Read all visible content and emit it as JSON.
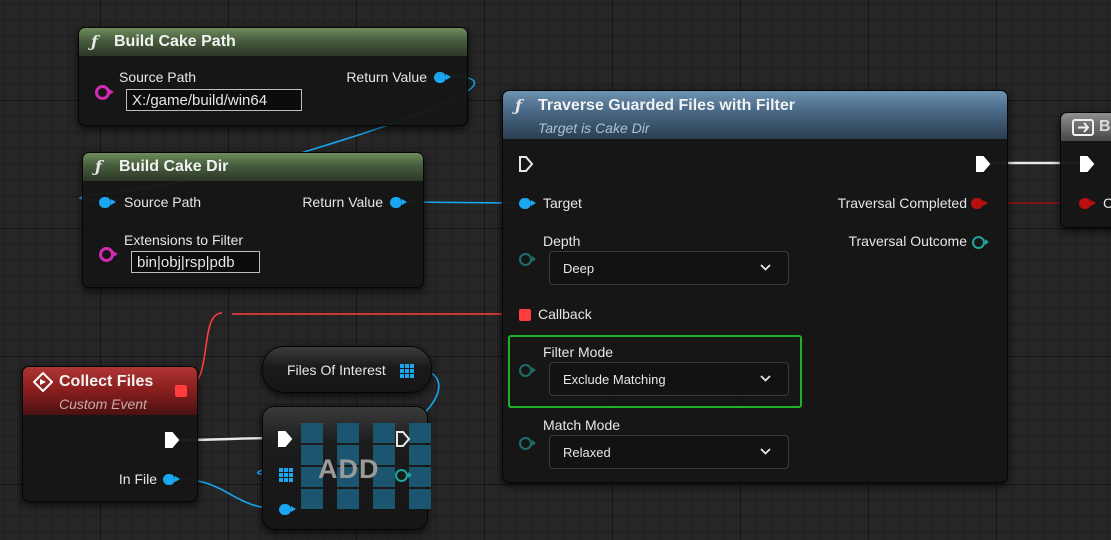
{
  "nodes": {
    "build_cake_path": {
      "title": "Build Cake Path",
      "source_path_label": "Source Path",
      "source_path_value": "X:/game/build/win64",
      "return_value_label": "Return Value"
    },
    "build_cake_dir": {
      "title": "Build Cake Dir",
      "source_path_label": "Source Path",
      "return_value_label": "Return Value",
      "extensions_label": "Extensions to Filter",
      "extensions_value": "bin|obj|rsp|pdb"
    },
    "traverse": {
      "title": "Traverse Guarded Files with Filter",
      "subtitle": "Target is Cake Dir",
      "target_label": "Target",
      "traversal_completed_label": "Traversal Completed",
      "traversal_outcome_label": "Traversal Outcome",
      "depth_label": "Depth",
      "depth_value": "Deep",
      "callback_label": "Callback",
      "filter_mode_label": "Filter Mode",
      "filter_mode_value": "Exclude Matching",
      "match_mode_label": "Match Mode",
      "match_mode_value": "Relaxed"
    },
    "collect_files": {
      "title": "Collect Files",
      "subtitle": "Custom Event",
      "in_file_label": "In File"
    },
    "files_of_interest": {
      "label": "Files Of Interest"
    },
    "add": {
      "label": "ADD"
    },
    "partial_right": {
      "title": "Br",
      "pin_label": "C"
    }
  },
  "colors": {
    "exec_wire": "#e8e8e8",
    "string_pin": "#d12bb4",
    "object_pin": "#1aa6f0",
    "delegate_pin": "#ff3d3d",
    "enum_pin": "#1f6d6a",
    "focus": "#1fb324",
    "pure_header": "#4a6140",
    "call_header": "#4d6e8c",
    "event_header": "#8c1f1f"
  },
  "icons": {
    "function": "function-icon",
    "event": "event-diamond-icon",
    "exec": "exec-pin-icon",
    "array": "array-grid-icon",
    "dropdown": "chevron-down-icon",
    "branch": "branch-icon"
  }
}
